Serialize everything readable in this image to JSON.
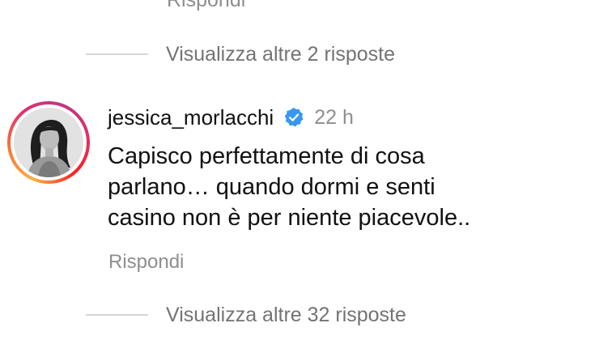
{
  "previous_comment": {
    "reply_label": "Rispondi"
  },
  "thread_1": {
    "view_more_label": "Visualizza altre 2 risposte"
  },
  "comment": {
    "username": "jessica_morlacchi",
    "verified": true,
    "verified_icon": "verified-badge-icon",
    "time": "22 h",
    "text_lines": [
      "Capisco perfettamente di cosa",
      "parlano… quando dormi e senti",
      "casino non è per niente piacevole.."
    ],
    "reply_label": "Rispondi",
    "avatar_icon": "profile-photo",
    "ring_colors": [
      "#fcaf45",
      "#f77737",
      "#e1306c",
      "#c13584",
      "#fd1d1d"
    ]
  },
  "thread_2": {
    "view_more_label": "Visualizza altre 32 risposte"
  },
  "colors": {
    "secondary_text": "#8e8e8e",
    "view_more_text": "#737373",
    "verified_blue": "#3897f0",
    "primary_text": "#111111"
  }
}
